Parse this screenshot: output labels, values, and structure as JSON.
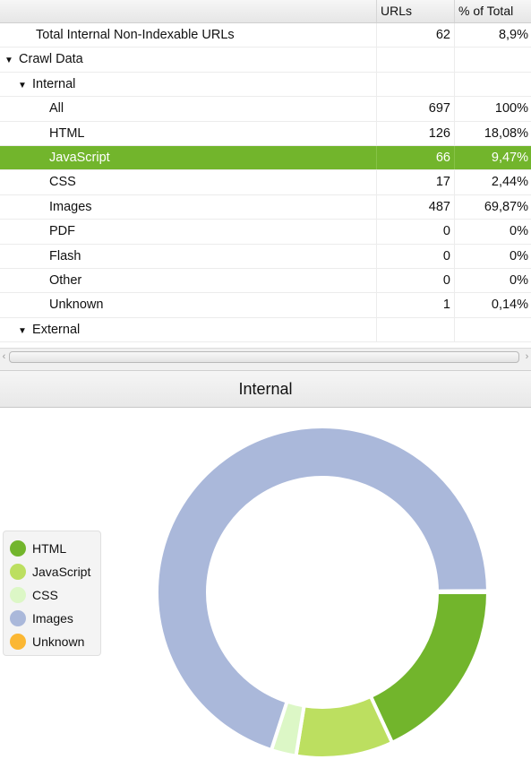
{
  "table": {
    "columns": [
      "",
      "URLs",
      "% of Total"
    ],
    "rows": [
      {
        "label": "Total Internal Non-Indexable URLs",
        "level": "total",
        "arrow": "",
        "urls": "62",
        "pct": "8,9%",
        "selected": false
      },
      {
        "label": "Crawl Data",
        "level": "0",
        "arrow": "▼",
        "urls": "",
        "pct": "",
        "selected": false
      },
      {
        "label": "Internal",
        "level": "1",
        "arrow": "▼",
        "urls": "",
        "pct": "",
        "selected": false
      },
      {
        "label": "All",
        "level": "2",
        "arrow": "",
        "urls": "697",
        "pct": "100%",
        "selected": false
      },
      {
        "label": "HTML",
        "level": "2",
        "arrow": "",
        "urls": "126",
        "pct": "18,08%",
        "selected": false
      },
      {
        "label": "JavaScript",
        "level": "2",
        "arrow": "",
        "urls": "66",
        "pct": "9,47%",
        "selected": true
      },
      {
        "label": "CSS",
        "level": "2",
        "arrow": "",
        "urls": "17",
        "pct": "2,44%",
        "selected": false
      },
      {
        "label": "Images",
        "level": "2",
        "arrow": "",
        "urls": "487",
        "pct": "69,87%",
        "selected": false
      },
      {
        "label": "PDF",
        "level": "2",
        "arrow": "",
        "urls": "0",
        "pct": "0%",
        "selected": false
      },
      {
        "label": "Flash",
        "level": "2",
        "arrow": "",
        "urls": "0",
        "pct": "0%",
        "selected": false
      },
      {
        "label": "Other",
        "level": "2",
        "arrow": "",
        "urls": "0",
        "pct": "0%",
        "selected": false
      },
      {
        "label": "Unknown",
        "level": "2",
        "arrow": "",
        "urls": "1",
        "pct": "0,14%",
        "selected": false
      },
      {
        "label": "External",
        "level": "1",
        "arrow": "▼",
        "urls": "",
        "pct": "",
        "selected": false
      }
    ],
    "selected_color": "#72b52c"
  },
  "scrollbar": {
    "left_arrow": "‹",
    "right_arrow": "›"
  },
  "chart_panel": {
    "title": "Internal"
  },
  "chart_data": {
    "type": "pie",
    "variant": "donut",
    "title": "Internal",
    "categories": [
      "HTML",
      "JavaScript",
      "CSS",
      "Images",
      "Unknown"
    ],
    "values": [
      126,
      66,
      17,
      487,
      1
    ],
    "colors": [
      "#72b52c",
      "#bcdf60",
      "#dcf7c6",
      "#aab8da",
      "#fbb733"
    ],
    "legend": "left",
    "start_angle": "3 o'clock, clockwise"
  }
}
